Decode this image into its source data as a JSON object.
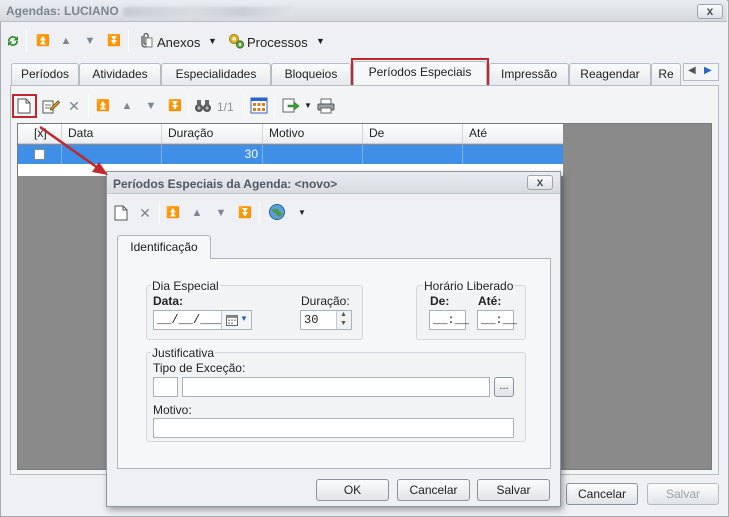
{
  "window": {
    "title": "Agendas: LUCIANO",
    "close_label": "x"
  },
  "main_toolbar": {
    "page_counter": "1/1",
    "anexos_label": "Anexos",
    "processos_label": "Processos",
    "dropdown_arrow": "▼"
  },
  "tabs": [
    "Períodos",
    "Atividades",
    "Especialidades",
    "Bloqueios",
    "Períodos Especiais",
    "Impressão",
    "Reagendar",
    "Re"
  ],
  "grid": {
    "columns": [
      "[x]",
      "Data",
      "Duração",
      "Motivo",
      "De",
      "Até"
    ],
    "rows": [
      {
        "data": "",
        "duracao": "30",
        "motivo": "",
        "de": "",
        "ate": ""
      }
    ]
  },
  "dialog": {
    "title": "Períodos Especiais da Agenda: <novo>",
    "close_label": "x",
    "tab": "Identificação",
    "dia_especial": {
      "legend": "Dia Especial",
      "data_label": "Data:",
      "data_value": "__/__/____",
      "duracao_label": "Duração:",
      "duracao_value": "30"
    },
    "horario": {
      "legend": "Horário Liberado",
      "de_label": "De:",
      "ate_label": "Até:",
      "de_value": "__:__",
      "ate_value": "__:__"
    },
    "justificativa": {
      "legend": "Justificativa",
      "tipo_label": "Tipo de Exceção:",
      "tipo_code": "",
      "tipo_desc": "",
      "ellipsis": "...",
      "motivo_label": "Motivo:",
      "motivo_value": ""
    },
    "buttons": {
      "ok": "OK",
      "cancelar": "Cancelar",
      "salvar": "Salvar"
    }
  },
  "footer_buttons": {
    "cancelar": "Cancelar",
    "salvar": "Salvar"
  },
  "colors": {
    "selection": "#3f8fe8",
    "highlight_red": "#c0282d",
    "title_text": "#4f5864"
  }
}
